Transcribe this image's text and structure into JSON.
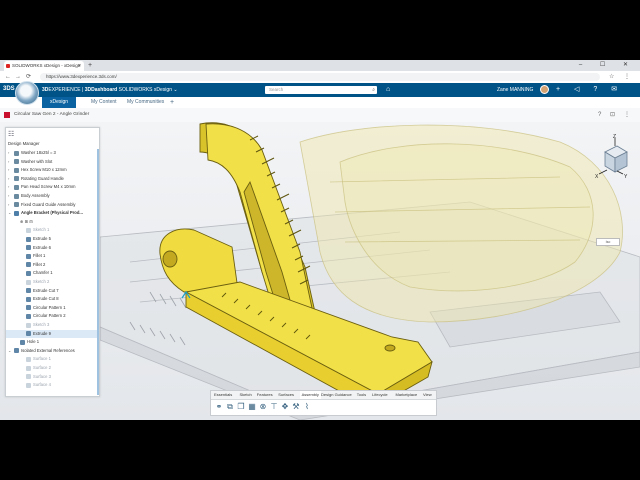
{
  "browser": {
    "tab_title": "SOLIDWORKS xDesign - xDesign",
    "new_tab_symbol": "+",
    "window_controls": "– ☐ ✕",
    "url": "https://www.3dexperience.3ds.com/",
    "back_icon": "←",
    "forward_icon": "→",
    "reload_icon": "⟳",
    "address_icons": "☆ ⋮"
  },
  "topbar": {
    "logo": "3DS",
    "brand_bold": "3D",
    "brand_rest": "EXPERIENCE | ",
    "brand_app_bold": "3DDashboard",
    "brand_app_rest": " SOLIDWORKS xDesign ⌄",
    "search_placeholder": "Search",
    "search_icon": "⌕",
    "tag_icon": "⌂",
    "user_name": "Zane MANNING",
    "icons": "+ ◁ ? ✉"
  },
  "tabs": [
    {
      "label": "xDesign"
    },
    {
      "label": "My Content"
    },
    {
      "label": "My Communities"
    },
    {
      "label": "+"
    }
  ],
  "app": {
    "title": "Circular Saw Gen 2 - Angle Grinder",
    "help_icon": "?",
    "lock_icon": "⊡",
    "menu_icon": "⋮"
  },
  "design_manager": {
    "header_icon": "☷",
    "title": "Design Manager",
    "rows": [
      {
        "label": "Washer 18x25l = 3",
        "indent": 1,
        "color": "#6a8aa0",
        "arrow": "›",
        "state": "normal"
      },
      {
        "label": "Washer with Slot",
        "indent": 1,
        "color": "#6a8aa0",
        "arrow": "›",
        "state": "normal"
      },
      {
        "label": "Hex Screw M10 x 12mm",
        "indent": 1,
        "color": "#6a8aa0",
        "arrow": "›",
        "state": "normal"
      },
      {
        "label": "Rotating Guard Handle",
        "indent": 1,
        "color": "#6a8aa0",
        "arrow": "›",
        "state": "normal"
      },
      {
        "label": "Pan Head Screw M4 x 10mm",
        "indent": 1,
        "color": "#6a8aa0",
        "arrow": "›",
        "state": "normal"
      },
      {
        "label": "Body Assembly",
        "indent": 1,
        "color": "#6a8aa0",
        "arrow": "›",
        "state": "normal"
      },
      {
        "label": "Fixed Guard Guide Assembly",
        "indent": 1,
        "color": "#6a8aa0",
        "arrow": "›",
        "state": "normal"
      },
      {
        "label": "Angle Bracket (Physical Prod...",
        "indent": 1,
        "color": "#4d7fa8",
        "arrow": "⌄",
        "state": "bold"
      },
      {
        "label": "⊕  ⊞  ⊟",
        "indent": 2,
        "color": "",
        "arrow": "",
        "state": "tools"
      },
      {
        "label": "Sketch 1",
        "indent": 3,
        "color": "#c9d3dc",
        "arrow": "",
        "state": "dim"
      },
      {
        "label": "Extrude 5",
        "indent": 3,
        "color": "#5f86a6",
        "arrow": "",
        "state": "normal"
      },
      {
        "label": "Extrude 6",
        "indent": 3,
        "color": "#5f86a6",
        "arrow": "",
        "state": "normal"
      },
      {
        "label": "Fillet 1",
        "indent": 3,
        "color": "#5f86a6",
        "arrow": "",
        "state": "normal"
      },
      {
        "label": "Fillet 2",
        "indent": 3,
        "color": "#5f86a6",
        "arrow": "",
        "state": "normal"
      },
      {
        "label": "Chamfer 1",
        "indent": 3,
        "color": "#5f86a6",
        "arrow": "",
        "state": "normal"
      },
      {
        "label": "Sketch 2",
        "indent": 3,
        "color": "#c9d3dc",
        "arrow": "",
        "state": "dim"
      },
      {
        "label": "Extrude Cut 7",
        "indent": 3,
        "color": "#5f86a6",
        "arrow": "",
        "state": "normal"
      },
      {
        "label": "Extrude Cut 8",
        "indent": 3,
        "color": "#5f86a6",
        "arrow": "",
        "state": "normal"
      },
      {
        "label": "Circular Pattern 1",
        "indent": 3,
        "color": "#5f86a6",
        "arrow": "",
        "state": "normal"
      },
      {
        "label": "Circular Pattern 2",
        "indent": 3,
        "color": "#5f86a6",
        "arrow": "",
        "state": "normal"
      },
      {
        "label": "Sketch 3",
        "indent": 3,
        "color": "#c9d3dc",
        "arrow": "",
        "state": "dim"
      },
      {
        "label": "Extrude 9",
        "indent": 3,
        "color": "#5f86a6",
        "arrow": "",
        "state": "selected"
      },
      {
        "label": "Hole 1",
        "indent": 2,
        "color": "#5f86a6",
        "arrow": "",
        "state": "normal"
      },
      {
        "label": "Isolated External References",
        "indent": 1,
        "color": "#5f86a6",
        "arrow": "⌄",
        "state": "normal"
      },
      {
        "label": "Surface 1",
        "indent": 3,
        "color": "#c9d3dc",
        "arrow": "",
        "state": "dim"
      },
      {
        "label": "Surface 2",
        "indent": 3,
        "color": "#c9d3dc",
        "arrow": "",
        "state": "dim"
      },
      {
        "label": "Surface 3",
        "indent": 3,
        "color": "#c9d3dc",
        "arrow": "",
        "state": "dim"
      },
      {
        "label": "Surface 4",
        "indent": 3,
        "color": "#c9d3dc",
        "arrow": "",
        "state": "dim"
      }
    ]
  },
  "toolbar": {
    "tabs": [
      {
        "label": "Essentials"
      },
      {
        "label": "Sketch"
      },
      {
        "label": "Features"
      },
      {
        "label": "Surfaces"
      },
      {
        "label": "Assembly"
      },
      {
        "label": "Design Guidance"
      },
      {
        "label": "Tools"
      },
      {
        "label": "Lifecycle"
      },
      {
        "label": "Marketplace"
      },
      {
        "label": "View"
      }
    ],
    "active_tab": "Assembly",
    "icons": [
      {
        "name": "link-icon",
        "glyph": "⚭"
      },
      {
        "name": "insert-icon",
        "glyph": "⧉"
      },
      {
        "name": "components-icon",
        "glyph": "❐"
      },
      {
        "name": "pattern-icon",
        "glyph": "▦"
      },
      {
        "name": "mate-icon",
        "glyph": "⊗"
      },
      {
        "name": "fix-icon",
        "glyph": "⊤"
      },
      {
        "name": "move-icon",
        "glyph": "✥"
      },
      {
        "name": "explode-icon",
        "glyph": "⚒"
      },
      {
        "name": "measure-icon",
        "glyph": "⌇"
      }
    ]
  },
  "view": {
    "zoom_label": "Iso"
  },
  "colors": {
    "topbar": "#005386",
    "part_yellow": "#f2e048",
    "accent": "#0a63a0"
  }
}
